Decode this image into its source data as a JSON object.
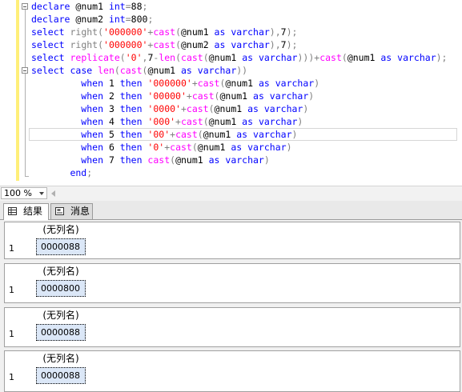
{
  "editor": {
    "lines": [
      [
        {
          "t": "declare ",
          "c": "kw"
        },
        {
          "t": "@num1 ",
          "c": ""
        },
        {
          "t": "int",
          "c": "kw"
        },
        {
          "t": "=",
          "c": "op"
        },
        {
          "t": "88",
          "c": ""
        },
        {
          "t": ";",
          "c": "pn"
        }
      ],
      [
        {
          "t": "declare ",
          "c": "kw"
        },
        {
          "t": "@num2 ",
          "c": ""
        },
        {
          "t": "int",
          "c": "kw"
        },
        {
          "t": "=",
          "c": "op"
        },
        {
          "t": "800",
          "c": ""
        },
        {
          "t": ";",
          "c": "pn"
        }
      ],
      [
        {
          "t": "select ",
          "c": "kw"
        },
        {
          "t": "right",
          "c": "gr"
        },
        {
          "t": "(",
          "c": "pn"
        },
        {
          "t": "'000000'",
          "c": "str"
        },
        {
          "t": "+",
          "c": "op"
        },
        {
          "t": "cast",
          "c": "fn"
        },
        {
          "t": "(",
          "c": "pn"
        },
        {
          "t": "@num1 ",
          "c": ""
        },
        {
          "t": "as ",
          "c": "kw"
        },
        {
          "t": "varchar",
          "c": "kw"
        },
        {
          "t": "),",
          "c": "pn"
        },
        {
          "t": "7",
          "c": ""
        },
        {
          "t": ");",
          "c": "pn"
        }
      ],
      [
        {
          "t": "select ",
          "c": "kw"
        },
        {
          "t": "right",
          "c": "gr"
        },
        {
          "t": "(",
          "c": "pn"
        },
        {
          "t": "'000000'",
          "c": "str"
        },
        {
          "t": "+",
          "c": "op"
        },
        {
          "t": "cast",
          "c": "fn"
        },
        {
          "t": "(",
          "c": "pn"
        },
        {
          "t": "@num2 ",
          "c": ""
        },
        {
          "t": "as ",
          "c": "kw"
        },
        {
          "t": "varchar",
          "c": "kw"
        },
        {
          "t": "),",
          "c": "pn"
        },
        {
          "t": "7",
          "c": ""
        },
        {
          "t": ");",
          "c": "pn"
        }
      ],
      [
        {
          "t": "select ",
          "c": "kw"
        },
        {
          "t": "replicate",
          "c": "fn"
        },
        {
          "t": "(",
          "c": "pn"
        },
        {
          "t": "'0'",
          "c": "str"
        },
        {
          "t": ",",
          "c": "pn"
        },
        {
          "t": "7",
          "c": ""
        },
        {
          "t": "-",
          "c": "op"
        },
        {
          "t": "len",
          "c": "fn"
        },
        {
          "t": "(",
          "c": "pn"
        },
        {
          "t": "cast",
          "c": "fn"
        },
        {
          "t": "(",
          "c": "pn"
        },
        {
          "t": "@num1 ",
          "c": ""
        },
        {
          "t": "as ",
          "c": "kw"
        },
        {
          "t": "varchar",
          "c": "kw"
        },
        {
          "t": ")))",
          "c": "pn"
        },
        {
          "t": "+",
          "c": "op"
        },
        {
          "t": "cast",
          "c": "fn"
        },
        {
          "t": "(",
          "c": "pn"
        },
        {
          "t": "@num1 ",
          "c": ""
        },
        {
          "t": "as ",
          "c": "kw"
        },
        {
          "t": "varchar",
          "c": "kw"
        },
        {
          "t": ");",
          "c": "pn"
        }
      ],
      [
        {
          "t": "select ",
          "c": "kw"
        },
        {
          "t": "case ",
          "c": "kw"
        },
        {
          "t": "len",
          "c": "fn"
        },
        {
          "t": "(",
          "c": "pn"
        },
        {
          "t": "cast",
          "c": "fn"
        },
        {
          "t": "(",
          "c": "pn"
        },
        {
          "t": "@num1 ",
          "c": ""
        },
        {
          "t": "as ",
          "c": "kw"
        },
        {
          "t": "varchar",
          "c": "kw"
        },
        {
          "t": "))",
          "c": "pn"
        }
      ],
      [
        {
          "t": "         when ",
          "c": "kw"
        },
        {
          "t": "1 ",
          "c": ""
        },
        {
          "t": "then ",
          "c": "kw"
        },
        {
          "t": "'000000'",
          "c": "str"
        },
        {
          "t": "+",
          "c": "op"
        },
        {
          "t": "cast",
          "c": "fn"
        },
        {
          "t": "(",
          "c": "pn"
        },
        {
          "t": "@num1 ",
          "c": ""
        },
        {
          "t": "as ",
          "c": "kw"
        },
        {
          "t": "varchar",
          "c": "kw"
        },
        {
          "t": ")",
          "c": "pn"
        }
      ],
      [
        {
          "t": "         when ",
          "c": "kw"
        },
        {
          "t": "2 ",
          "c": ""
        },
        {
          "t": "then ",
          "c": "kw"
        },
        {
          "t": "'00000'",
          "c": "str"
        },
        {
          "t": "+",
          "c": "op"
        },
        {
          "t": "cast",
          "c": "fn"
        },
        {
          "t": "(",
          "c": "pn"
        },
        {
          "t": "@num1 ",
          "c": ""
        },
        {
          "t": "as ",
          "c": "kw"
        },
        {
          "t": "varchar",
          "c": "kw"
        },
        {
          "t": ")",
          "c": "pn"
        }
      ],
      [
        {
          "t": "         when ",
          "c": "kw"
        },
        {
          "t": "3 ",
          "c": ""
        },
        {
          "t": "then ",
          "c": "kw"
        },
        {
          "t": "'0000'",
          "c": "str"
        },
        {
          "t": "+",
          "c": "op"
        },
        {
          "t": "cast",
          "c": "fn"
        },
        {
          "t": "(",
          "c": "pn"
        },
        {
          "t": "@num1 ",
          "c": ""
        },
        {
          "t": "as ",
          "c": "kw"
        },
        {
          "t": "varchar",
          "c": "kw"
        },
        {
          "t": ")",
          "c": "pn"
        }
      ],
      [
        {
          "t": "         when ",
          "c": "kw"
        },
        {
          "t": "4 ",
          "c": ""
        },
        {
          "t": "then ",
          "c": "kw"
        },
        {
          "t": "'000'",
          "c": "str"
        },
        {
          "t": "+",
          "c": "op"
        },
        {
          "t": "cast",
          "c": "fn"
        },
        {
          "t": "(",
          "c": "pn"
        },
        {
          "t": "@num1 ",
          "c": ""
        },
        {
          "t": "as ",
          "c": "kw"
        },
        {
          "t": "varchar",
          "c": "kw"
        },
        {
          "t": ")",
          "c": "pn"
        }
      ],
      [
        {
          "t": "         when ",
          "c": "kw"
        },
        {
          "t": "5 ",
          "c": ""
        },
        {
          "t": "then ",
          "c": "kw"
        },
        {
          "t": "'00'",
          "c": "str"
        },
        {
          "t": "+",
          "c": "op"
        },
        {
          "t": "cast",
          "c": "fn"
        },
        {
          "t": "(",
          "c": "pn"
        },
        {
          "t": "@num1 ",
          "c": ""
        },
        {
          "t": "as ",
          "c": "kw"
        },
        {
          "t": "varchar",
          "c": "kw"
        },
        {
          "t": ")",
          "c": "pn"
        }
      ],
      [
        {
          "t": "         when ",
          "c": "kw"
        },
        {
          "t": "6 ",
          "c": ""
        },
        {
          "t": "then ",
          "c": "kw"
        },
        {
          "t": "'0'",
          "c": "str"
        },
        {
          "t": "+",
          "c": "op"
        },
        {
          "t": "cast",
          "c": "fn"
        },
        {
          "t": "(",
          "c": "pn"
        },
        {
          "t": "@num1 ",
          "c": ""
        },
        {
          "t": "as ",
          "c": "kw"
        },
        {
          "t": "varchar",
          "c": "kw"
        },
        {
          "t": ")",
          "c": "pn"
        }
      ],
      [
        {
          "t": "         when ",
          "c": "kw"
        },
        {
          "t": "7 ",
          "c": ""
        },
        {
          "t": "then ",
          "c": "kw"
        },
        {
          "t": "cast",
          "c": "fn"
        },
        {
          "t": "(",
          "c": "pn"
        },
        {
          "t": "@num1 ",
          "c": ""
        },
        {
          "t": "as ",
          "c": "kw"
        },
        {
          "t": "varchar",
          "c": "kw"
        },
        {
          "t": ")",
          "c": "pn"
        }
      ],
      [
        {
          "t": "       end",
          "c": "kw"
        },
        {
          "t": ";",
          "c": "pn"
        }
      ]
    ]
  },
  "status": {
    "zoom": "100 %"
  },
  "tabs": [
    {
      "label": "结果",
      "icon": "grid-icon",
      "active": true
    },
    {
      "label": "消息",
      "icon": "message-icon",
      "active": false
    }
  ],
  "results": [
    {
      "column": "(无列名)",
      "row_number": "1",
      "value": "0000088"
    },
    {
      "column": "(无列名)",
      "row_number": "1",
      "value": "0000800"
    },
    {
      "column": "(无列名)",
      "row_number": "1",
      "value": "0000088"
    },
    {
      "column": "(无列名)",
      "row_number": "1",
      "value": "0000088"
    }
  ]
}
